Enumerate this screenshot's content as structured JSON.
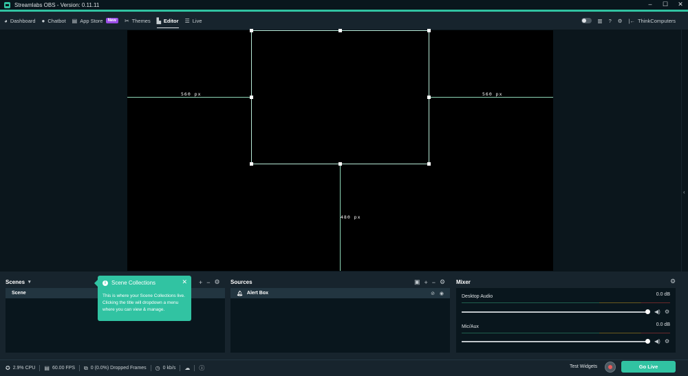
{
  "window": {
    "title": "Streamlabs OBS - Version: 0.11.11",
    "controls": [
      "–",
      "☐",
      "✕"
    ]
  },
  "nav": {
    "items": [
      {
        "label": "Dashboard",
        "icon": "dashboard-icon"
      },
      {
        "label": "Chatbot",
        "icon": "chatbot-icon"
      },
      {
        "label": "App Store",
        "icon": "store-icon",
        "badge": "New"
      },
      {
        "label": "Themes",
        "icon": "themes-icon"
      },
      {
        "label": "Editor",
        "icon": "editor-icon",
        "active": true
      },
      {
        "label": "Live",
        "icon": "live-icon"
      }
    ],
    "user": "ThinkComputers"
  },
  "editor": {
    "guide_left": "560 px",
    "guide_right": "560 px",
    "guide_bottom": "480 px"
  },
  "scenes": {
    "title": "Scenes",
    "items": [
      "Scene"
    ]
  },
  "tooltip": {
    "title": "Scene Collections",
    "body": "This is where your Scene Collections live. Clicking the title will dropdown a menu where you can view & manage."
  },
  "sources": {
    "title": "Sources",
    "items": [
      "Alert Box"
    ]
  },
  "mixer": {
    "title": "Mixer",
    "channels": [
      {
        "name": "Desktop Audio",
        "db": "0.0 dB",
        "level": 1.0
      },
      {
        "name": "Mic/Aux",
        "db": "0.0 dB",
        "level": 1.0
      }
    ]
  },
  "footer": {
    "cpu": "2.9% CPU",
    "fps": "60.00 FPS",
    "dropped": "0 (0.0%) Dropped Frames",
    "bandwidth": "0 kb/s",
    "test_widgets": "Test Widgets",
    "go_live": "Go Live"
  },
  "colors": {
    "accent": "#31c3a2",
    "badge": "#9b4de7",
    "background": "#17242d"
  }
}
